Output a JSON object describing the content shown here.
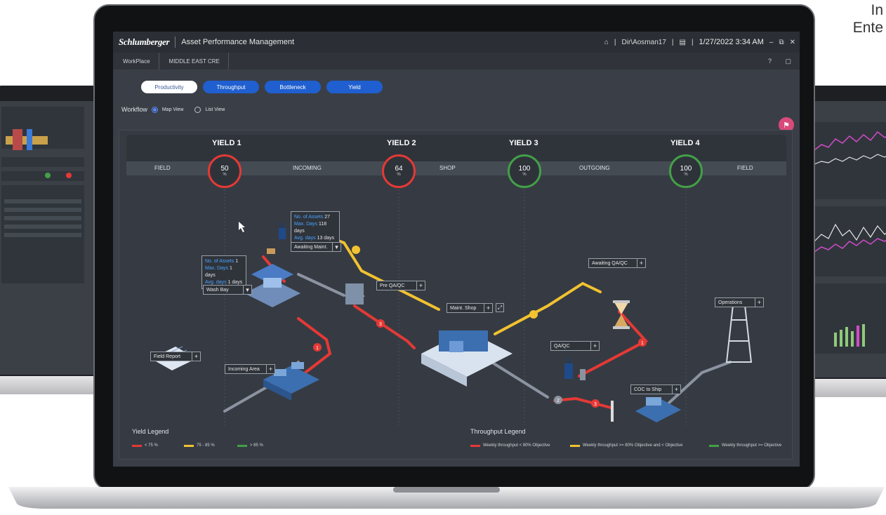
{
  "corner_text": [
    "In",
    "Ente"
  ],
  "app": {
    "logo": "Schlumberger",
    "title": "Asset Performance Management",
    "user": "Dir\\Aosman17",
    "datetime": "1/27/2022 3:34 AM"
  },
  "breadcrumb": [
    "WorkPlace",
    "MIDDLE EAST CRE"
  ],
  "tabs": [
    {
      "label": "Productivity",
      "active": true
    },
    {
      "label": "Throughput",
      "active": false
    },
    {
      "label": "Bottleneck",
      "active": false
    },
    {
      "label": "Yield",
      "active": false
    }
  ],
  "workflow": {
    "label": "Workflow",
    "map_view": "Map View",
    "list_view": "List View",
    "selected": "Map View"
  },
  "yields": [
    {
      "title": "YIELD 1",
      "value": "50",
      "unit": "%",
      "color": "#e53935"
    },
    {
      "title": "YIELD 2",
      "value": "64",
      "unit": "%",
      "color": "#e53935"
    },
    {
      "title": "YIELD 3",
      "value": "100",
      "unit": "%",
      "color": "#43a047"
    },
    {
      "title": "YIELD 4",
      "value": "100",
      "unit": "%",
      "color": "#43a047"
    }
  ],
  "segments": [
    "FIELD",
    "INCOMING",
    "SHOP",
    "OUTGOING",
    "FIELD"
  ],
  "wash_bay_box": {
    "assets_k": "No. of Assets",
    "assets_v": "1",
    "max_k": "Max. Days",
    "max_v": "1 days",
    "avg_k": "Avg. days",
    "avg_v": "1 days",
    "label": "Wash Bay"
  },
  "awaiting_maint_box": {
    "assets_k": "No. of Assets",
    "assets_v": "27",
    "max_k": "Max. Days",
    "max_v": "118 days",
    "avg_k": "Avg. days",
    "avg_v": "13 days",
    "label": "Awaiting Maint."
  },
  "stations": {
    "pre_qaqc": "Pre QA/QC",
    "maint_shop": "Maint. Shop",
    "awaiting_qaqc": "Awaiting QA/QC",
    "operations": "Operations",
    "qaqc": "QA/QC",
    "coc_to_ship": "COC to Ship",
    "field_report": "Field Report",
    "incoming_area": "Incoming Area"
  },
  "step_numbers": [
    "1",
    "2",
    "3",
    "1",
    "2",
    "3"
  ],
  "yield_legend": {
    "title": "Yield Legend",
    "items": [
      {
        "label": "< 75 %",
        "color": "#e53935"
      },
      {
        "label": "75 - 85 %",
        "color": "#f2c230"
      },
      {
        "label": "> 85 %",
        "color": "#43a047"
      }
    ]
  },
  "throughput_legend": {
    "title": "Throughput Legend",
    "items": [
      {
        "label": "Weekly throughput < 80% Objective",
        "color": "#e53935"
      },
      {
        "label": "Weekly throughput >= 80% Objective and < Objective",
        "color": "#f2c230"
      },
      {
        "label": "Weekly throughput >= Objective",
        "color": "#43a047"
      }
    ]
  },
  "icons": [
    "home-icon",
    "window-icon",
    "minimize-icon",
    "restore-icon",
    "close-icon",
    "help-icon",
    "chat-icon",
    "flag-icon",
    "chevron-down-icon"
  ]
}
